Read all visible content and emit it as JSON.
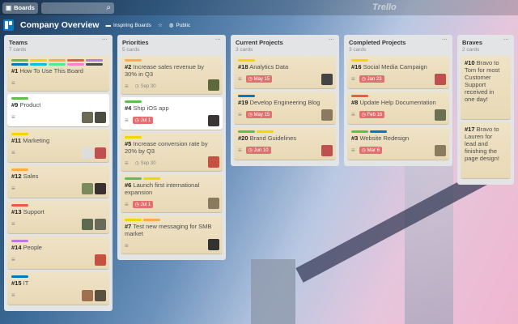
{
  "topbar": {
    "boards_label": "Boards",
    "search_placeholder": "",
    "logo": "Trello"
  },
  "board": {
    "title": "Company Overview",
    "team": "Inspiring Boards",
    "visibility": "Public"
  },
  "colors": {
    "green": "#61bd4f",
    "yellow": "#f2d600",
    "orange": "#ffab4a",
    "red": "#eb5a46",
    "purple": "#c377e0",
    "blue": "#0079bf",
    "sky": "#00c2e0",
    "lime": "#51e898",
    "pink": "#ff80ce",
    "black": "#4d4d4d"
  },
  "lists": [
    {
      "name": "Teams",
      "count": "7 cards",
      "cards": [
        {
          "num": "#1",
          "title": "How To Use This Board",
          "labels": [
            "green",
            "yellow",
            "orange",
            "red",
            "purple",
            "blue",
            "sky",
            "lime",
            "pink",
            "black"
          ],
          "desc": true,
          "avatars": []
        },
        {
          "num": "#9",
          "title": "Product",
          "labels": [
            "green"
          ],
          "desc": true,
          "avatars": [
            "#6b6b55",
            "#4a4d40"
          ],
          "white": true
        },
        {
          "num": "#11",
          "title": "Marketing",
          "labels": [
            "yellow"
          ],
          "desc": true,
          "avatars": [
            "#ddd",
            "#c0504d"
          ]
        },
        {
          "num": "#12",
          "title": "Sales",
          "labels": [
            "orange"
          ],
          "desc": true,
          "avatars": [
            "#7a8a5a",
            "#3a3030"
          ]
        },
        {
          "num": "#13",
          "title": "Support",
          "labels": [
            "red"
          ],
          "desc": true,
          "avatars": [
            "#5b6a50",
            "#6a6a5a"
          ]
        },
        {
          "num": "#14",
          "title": "People",
          "labels": [
            "purple"
          ],
          "desc": true,
          "avatars": [
            "#c85040"
          ]
        },
        {
          "num": "#15",
          "title": "IT",
          "labels": [
            "blue"
          ],
          "desc": true,
          "avatars": [
            "#a07050",
            "#5a5040"
          ]
        }
      ]
    },
    {
      "name": "Priorities",
      "count": "5 cards",
      "cards": [
        {
          "num": "#2",
          "title": "Increase sales revenue by 30% in Q3",
          "labels": [
            "orange"
          ],
          "desc": true,
          "due": "Sep 30",
          "due_plain": true,
          "avatars": [
            "#5a6a3a"
          ]
        },
        {
          "num": "#4",
          "title": "Ship iOS app",
          "labels": [
            "green"
          ],
          "desc": true,
          "due": "Jul 1",
          "avatars": [
            "#3a3535"
          ],
          "white": true
        },
        {
          "num": "#5",
          "title": "Increase conversion rate by 20% by Q3",
          "labels": [
            "yellow"
          ],
          "desc": true,
          "due": "Sep 30",
          "due_plain": true,
          "avatars": [
            "#c85040"
          ]
        },
        {
          "num": "#6",
          "title": "Launch first international expansion",
          "labels": [
            "green",
            "yellow"
          ],
          "desc": true,
          "due": "Jul 1",
          "avatars": [
            "#8a7a60"
          ]
        },
        {
          "num": "#7",
          "title": "Test new messaging for SMB market",
          "labels": [
            "yellow",
            "orange"
          ],
          "desc": true,
          "avatars": [
            "#333"
          ]
        }
      ]
    },
    {
      "name": "Current Projects",
      "count": "3 cards",
      "cards": [
        {
          "num": "#18",
          "title": "Analytics Data",
          "labels": [
            "yellow"
          ],
          "desc": true,
          "due": "May 15",
          "avatars": [
            "#444"
          ]
        },
        {
          "num": "#19",
          "title": "Develop Engineering Blog",
          "labels": [
            "blue"
          ],
          "desc": true,
          "due": "May 15",
          "avatars": [
            "#8a7a60"
          ]
        },
        {
          "num": "#20",
          "title": "Brand Guidelines",
          "labels": [
            "green",
            "yellow"
          ],
          "desc": true,
          "due": "Jun 10",
          "avatars": [
            "#c0504d"
          ]
        }
      ]
    },
    {
      "name": "Completed Projects",
      "count": "3 cards",
      "cards": [
        {
          "num": "#16",
          "title": "Social Media Campaign",
          "labels": [
            "yellow"
          ],
          "desc": true,
          "due": "Jan 23",
          "avatars": [
            "#c0504d"
          ]
        },
        {
          "num": "#8",
          "title": "Update Help Documentation",
          "labels": [
            "red"
          ],
          "desc": true,
          "due": "Feb 16",
          "avatars": [
            "#6a7050"
          ]
        },
        {
          "num": "#3",
          "title": "Website Redesign",
          "labels": [
            "green",
            "blue"
          ],
          "desc": true,
          "due": "Mar 6",
          "avatars": [
            "#8a7a60"
          ]
        }
      ]
    },
    {
      "name": "Braves",
      "count": "2 cards",
      "cards": [
        {
          "num": "#10",
          "title": "Bravo to Tom for most Customer Support received in one day!",
          "labels": [],
          "desc": false,
          "avatars": []
        },
        {
          "num": "#17",
          "title": "Bravo to Lauren for lead and finishing the page design!",
          "labels": [],
          "desc": false,
          "avatars": []
        }
      ]
    }
  ]
}
